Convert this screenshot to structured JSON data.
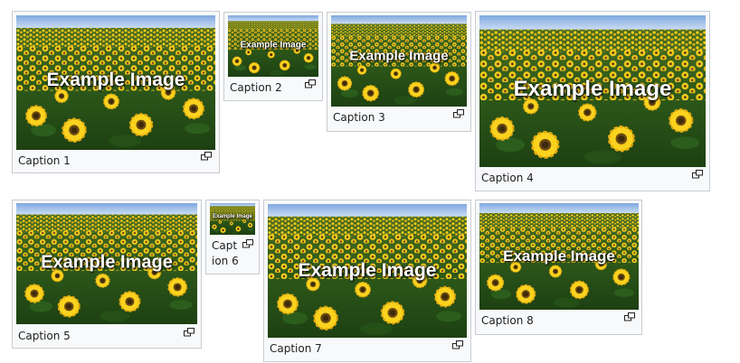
{
  "gallery": {
    "image_text": "Example Image",
    "enlarge_icon": "magnify-clip-icon",
    "colors": {
      "frame_border": "#c8ccd1",
      "frame_bg": "#f8f9fa",
      "caption_text": "#202122"
    },
    "items": [
      {
        "caption": "Caption 1"
      },
      {
        "caption": "Caption 2"
      },
      {
        "caption": "Caption 3"
      },
      {
        "caption": "Caption 4"
      },
      {
        "caption": "Caption 5"
      },
      {
        "caption": "Caption 6"
      },
      {
        "caption": "Caption 7"
      },
      {
        "caption": "Caption 8"
      }
    ]
  }
}
